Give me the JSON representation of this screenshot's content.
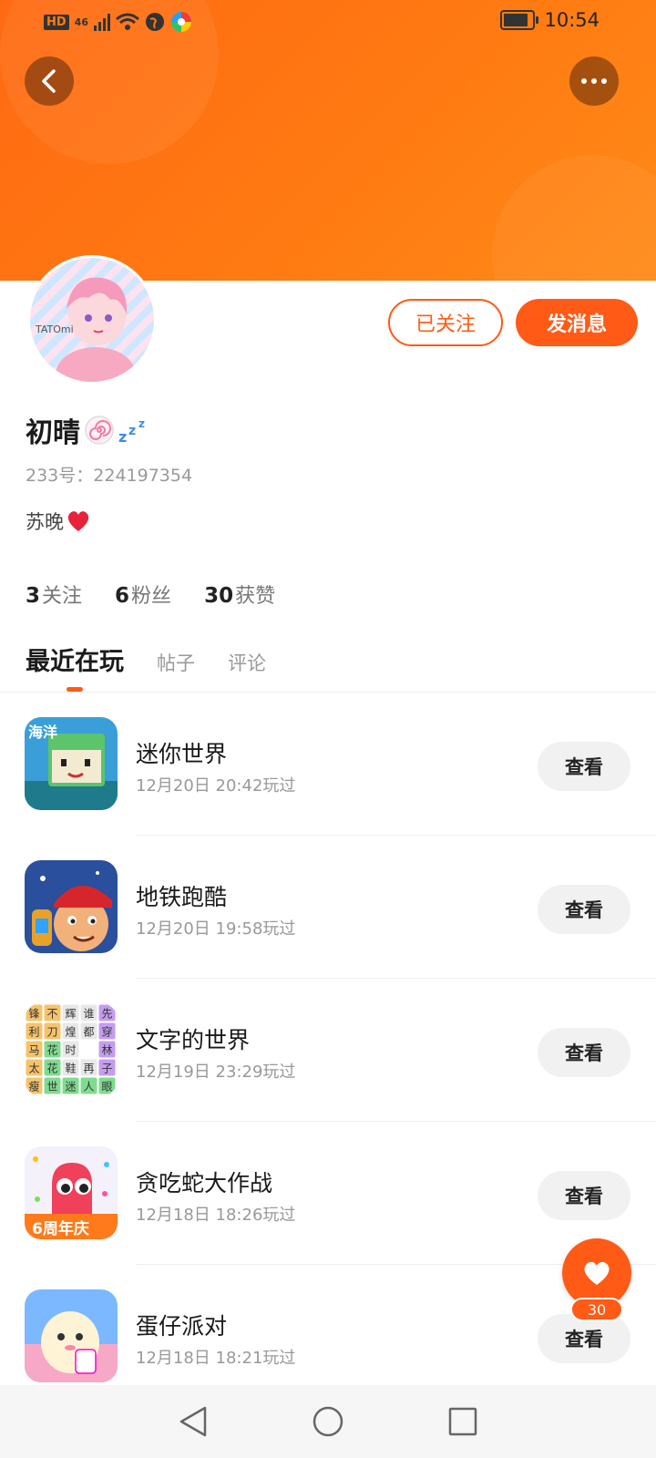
{
  "status_bar": {
    "network_label": "HD",
    "signal_label": "46",
    "time": "10:54"
  },
  "profile": {
    "name": "初晴",
    "uid": "233号：224197354",
    "bio": "苏晚",
    "follow_label": "已关注",
    "message_label": "发消息",
    "avatar_watermark": "TATOmi"
  },
  "stats": {
    "following_count": "3",
    "following_label": "关注",
    "fans_count": "6",
    "fans_label": "粉丝",
    "likes_count": "30",
    "likes_label": "获赞"
  },
  "tabs": [
    {
      "label": "最近在玩"
    },
    {
      "label": "帖子"
    },
    {
      "label": "评论"
    }
  ],
  "games": [
    {
      "title": "迷你世界",
      "played": "12月20日 20:42玩过",
      "button": "查看"
    },
    {
      "title": "地铁跑酷",
      "played": "12月20日 19:58玩过",
      "button": "查看"
    },
    {
      "title": "文字的世界",
      "played": "12月19日 23:29玩过",
      "button": "查看"
    },
    {
      "title": "贪吃蛇大作战",
      "played": "12月18日 18:26玩过",
      "button": "查看"
    },
    {
      "title": "蛋仔派对",
      "played": "12月18日 18:21玩过",
      "button": "查看"
    }
  ],
  "word_grid": [
    "锋",
    "不",
    "辉",
    "谁",
    "先",
    "利",
    "刀",
    "煌",
    "都",
    "穿",
    "马",
    "花",
    "时",
    "",
    "林",
    "太",
    "花",
    "鞋",
    "再",
    "子",
    "瘦",
    "世",
    "迷",
    "人",
    "眼"
  ],
  "game_icon_texts": {
    "mini_world": "海洋",
    "snake": "6周年庆"
  },
  "fab": {
    "count": "30"
  },
  "colors": {
    "accent": "#ff5a16",
    "header": "#ff7a12"
  }
}
